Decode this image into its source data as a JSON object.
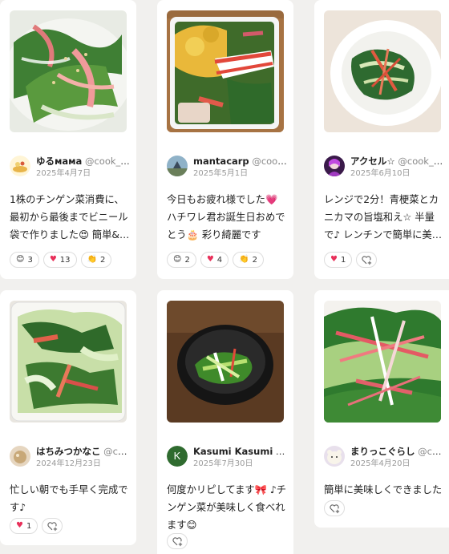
{
  "cards": [
    {
      "user_name": "ゆるмамa",
      "user_id": "@cook_40…",
      "date": "2025年4月7日",
      "comment": "1株のチンゲン菜消費に、最初から最後までビニール袋で作りました😍 簡単&美味し…",
      "reactions": [
        {
          "icon": "blushing-smile-emoji",
          "glyph": "😊",
          "count": "3"
        },
        {
          "icon": "heart-icon",
          "glyph": "♥",
          "count": "13"
        },
        {
          "icon": "clapping-hands-emoji",
          "glyph": "👏",
          "count": "2"
        }
      ]
    },
    {
      "user_name": "mantacarp",
      "user_id": "@cook_…",
      "date": "2025年5月1日",
      "comment": "今日もお疲れ様でした💗 ハチワレ君お誕生日おめでとう🎂 彩り綺麗です",
      "reactions": [
        {
          "icon": "blushing-smile-emoji",
          "glyph": "😊",
          "count": "2"
        },
        {
          "icon": "heart-icon",
          "glyph": "♥",
          "count": "4"
        },
        {
          "icon": "clapping-hands-emoji",
          "glyph": "👏",
          "count": "2"
        }
      ]
    },
    {
      "user_name": "アクセル☆",
      "user_id": "@cook_40…",
      "date": "2025年6月10日",
      "comment": "レンジで2分！青梗菜とカニカマの旨塩和え☆ 半量で♪ レンチンで簡単に美味しいレシ…",
      "reactions": [
        {
          "icon": "heart-icon",
          "glyph": "♥",
          "count": "1"
        }
      ]
    },
    {
      "user_name": "はちみつかなこ",
      "user_id": "@cook…",
      "date": "2024年12月23日",
      "comment": "忙しい朝でも手早く完成です♪",
      "reactions": [
        {
          "icon": "heart-icon",
          "glyph": "♥",
          "count": "1"
        }
      ]
    },
    {
      "user_name": "Kasumi Kasumi",
      "user_id": "@c…",
      "avatar_letter": "K",
      "date": "2025年7月30日",
      "comment": "何度かリピしてます🎀 ♪チンゲン菜が美味しく食べれます😊",
      "reactions": []
    },
    {
      "user_name": "まりっこぐらし",
      "user_id": "@cook_4…",
      "date": "2025年4月20日",
      "comment": "簡単に美味しくできました♡",
      "reactions": []
    }
  ],
  "colors": {
    "page_background": "#f1f0ee",
    "card_background": "#ffffff",
    "heart": "#e8305a",
    "date_text": "#999999"
  },
  "add_reaction_icon": "add-reaction-icon"
}
